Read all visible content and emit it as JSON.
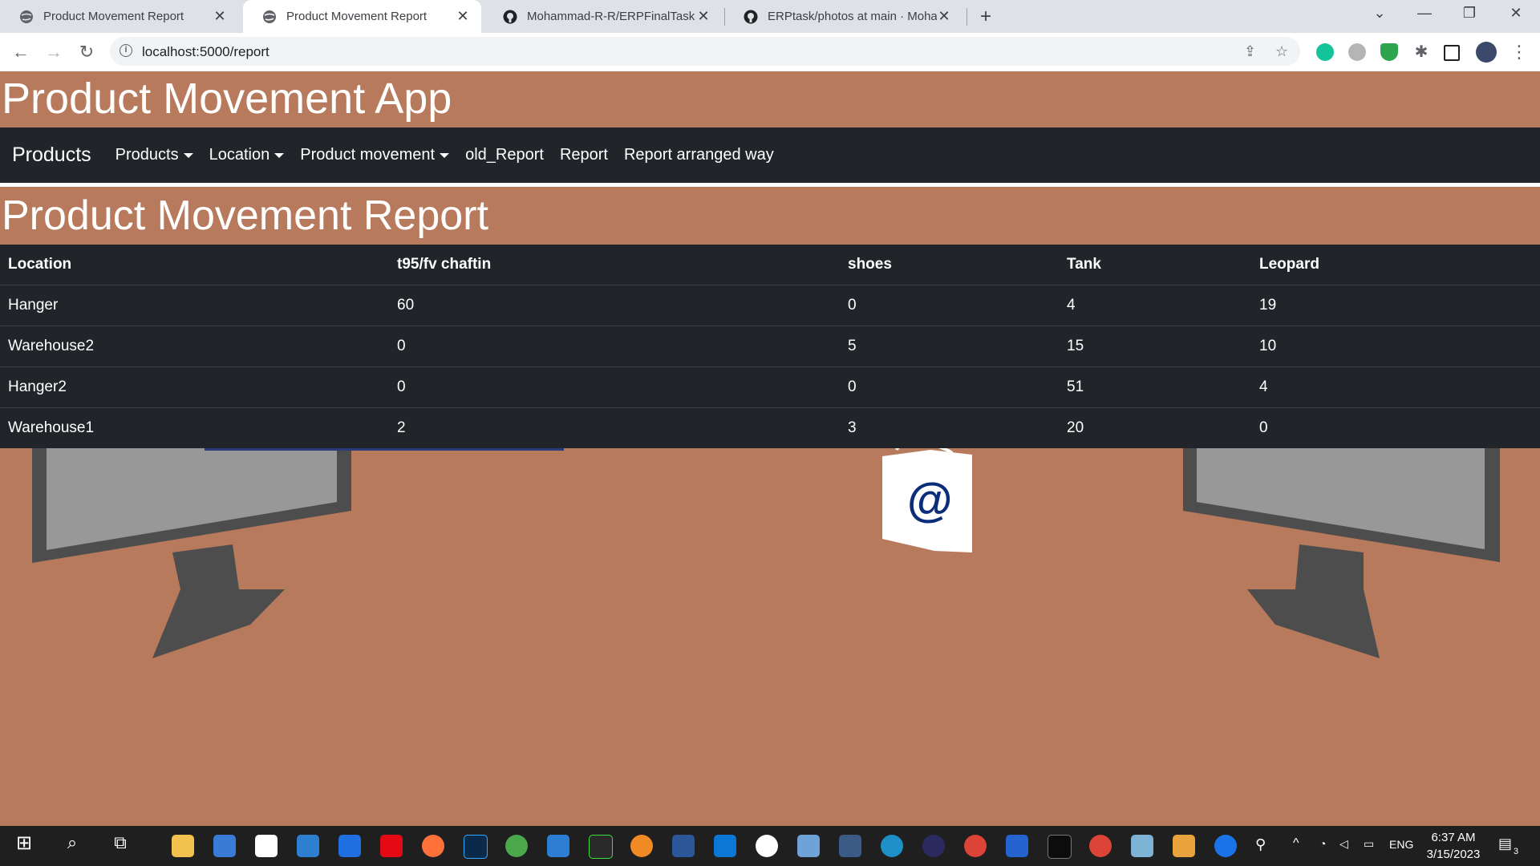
{
  "browser": {
    "tabs": [
      {
        "title": "Product Movement Report",
        "icon": "globe-icon"
      },
      {
        "title": "Product Movement Report",
        "icon": "globe-icon"
      },
      {
        "title": "Mohammad-R-R/ERPFinalTask",
        "icon": "github-icon"
      },
      {
        "title": "ERPtask/photos at main · Mohamr",
        "icon": "github-icon"
      }
    ],
    "url": "localhost:5000/report"
  },
  "app": {
    "title": "Product Movement App",
    "navbar": {
      "brand": "Products",
      "items": [
        {
          "label": "Products",
          "dropdown": true
        },
        {
          "label": "Location",
          "dropdown": true
        },
        {
          "label": "Product movement",
          "dropdown": true
        },
        {
          "label": "old_Report",
          "dropdown": false
        },
        {
          "label": "Report",
          "dropdown": false
        },
        {
          "label": "Report arranged way",
          "dropdown": false
        }
      ]
    },
    "report": {
      "title": "Product Movement Report",
      "headers": [
        "Location",
        "t95/fv chaftin",
        "shoes",
        "Tank",
        "Leopard"
      ],
      "rows": [
        [
          "Hanger",
          "60",
          "0",
          "4",
          "19"
        ],
        [
          "Warehouse2",
          "0",
          "5",
          "15",
          "10"
        ],
        [
          "Hanger2",
          "0",
          "0",
          "51",
          "4"
        ],
        [
          "Warehouse1",
          "2",
          "3",
          "20",
          "0"
        ]
      ]
    }
  },
  "taskbar": {
    "language": "ENG",
    "time": "6:37 AM",
    "date": "3/15/2023",
    "notification_count": "3"
  },
  "colors": {
    "page_bg": "#b87a5c",
    "navbar_bg": "#212529",
    "table_bg": "#212529"
  }
}
